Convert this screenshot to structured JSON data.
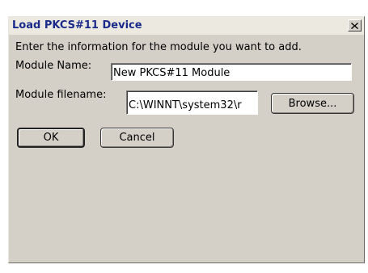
{
  "window": {
    "title": "Load PKCS#11 Device",
    "close_icon": "close-icon"
  },
  "instructions": "Enter the information for the module you want to add.",
  "module_name": {
    "label": "Module Name:",
    "value": "New PKCS#11 Module"
  },
  "module_filename": {
    "label": "Module filename:",
    "value": "C:\\WINNT\\system32\\r"
  },
  "buttons": {
    "browse": "Browse...",
    "ok": "OK",
    "cancel": "Cancel"
  },
  "colors": {
    "dialog_bg": "#d4d0c8",
    "title_text": "#1a2a8a",
    "titlebar_bg": "#ece9e1"
  }
}
